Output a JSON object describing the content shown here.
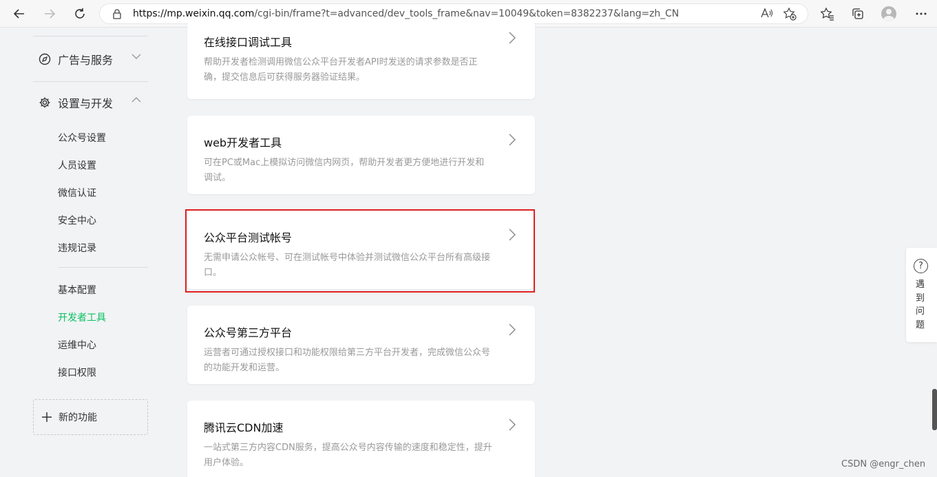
{
  "browser": {
    "url_host": "https://mp.weixin.qq.com",
    "url_rest": "/cgi-bin/frame?t=advanced/dev_tools_frame&nav=10049&token=8382237&lang=zh_CN",
    "read_aloud_label": "A)"
  },
  "sidebar": {
    "groups": [
      {
        "label": "广告与服务",
        "icon": "compass-icon",
        "chevron": "﹀"
      },
      {
        "label": "设置与开发",
        "icon": "gear-icon",
        "chevron": "︿"
      }
    ],
    "settings_items": [
      {
        "label": "公众号设置"
      },
      {
        "label": "人员设置"
      },
      {
        "label": "微信认证"
      },
      {
        "label": "安全中心"
      },
      {
        "label": "违规记录"
      }
    ],
    "dev_items": [
      {
        "label": "基本配置"
      },
      {
        "label": "开发者工具",
        "active": true
      },
      {
        "label": "运维中心"
      },
      {
        "label": "接口权限"
      }
    ],
    "new_feature_label": "新的功能",
    "active_color": "#07c160"
  },
  "cards": [
    {
      "title": "在线接口调试工具",
      "desc": "帮助开发者检测调用微信公众平台开发者API时发送的请求参数是否正确，提交信息后可获得服务器验证结果。"
    },
    {
      "title": "web开发者工具",
      "desc": "可在PC或Mac上模拟访问微信内网页，帮助开发者更方便地进行开发和调试。"
    },
    {
      "title": "公众平台测试帐号",
      "desc": "无需申请公众帐号、可在测试帐号中体验并测试微信公众平台所有高级接口。",
      "highlighted": true
    },
    {
      "title": "公众号第三方平台",
      "desc": "运营者可通过授权接口和功能权限给第三方平台开发者，完成微信公众号的功能开发和运营。"
    },
    {
      "title": "腾讯云CDN加速",
      "desc": "一站式第三方内容CDN服务，提高公众号内容传输的速度和稳定性，提升用户体验。"
    }
  ],
  "help": {
    "label": "遇到问题"
  },
  "watermark": "CSDN @engr_chen",
  "highlight_color": "#e02020"
}
